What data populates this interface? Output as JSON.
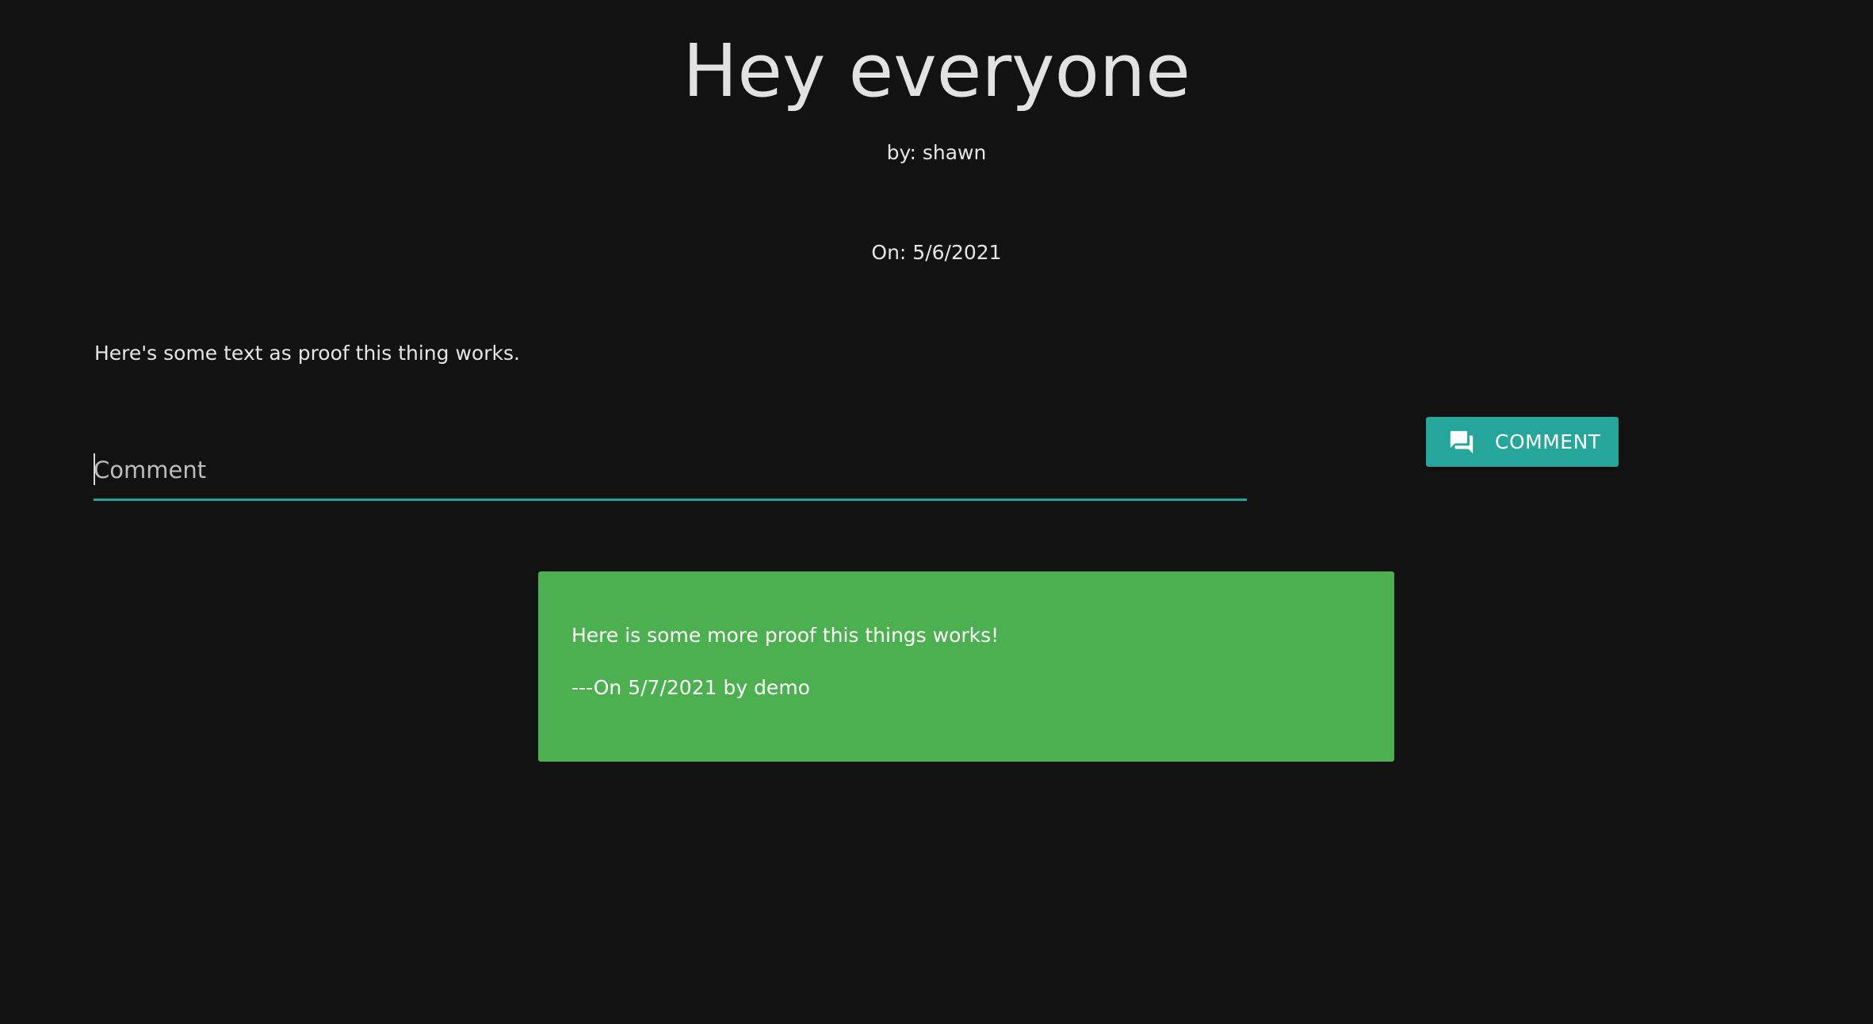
{
  "post": {
    "title": "Hey everyone",
    "author": "by: shawn",
    "date": "On: 5/6/2021",
    "body": "Here's some text as proof this thing works."
  },
  "comment_form": {
    "placeholder": "Comment",
    "value": "",
    "button_label": "COMMENT",
    "button_icon": "comment-icon",
    "accent_color": "#26a69a"
  },
  "comments": [
    {
      "text": "Here is some more proof this things works!",
      "meta": "---On 5/7/2021 by demo",
      "card_color": "#4caf50"
    }
  ]
}
